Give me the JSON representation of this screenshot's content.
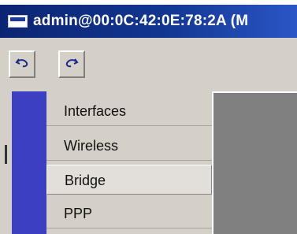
{
  "window": {
    "title": "admin@00:0C:42:0E:78:2A (M"
  },
  "toolbar": {
    "undo_icon": "undo-arrow-icon",
    "redo_icon": "redo-arrow-icon"
  },
  "menu": {
    "items": [
      {
        "label": "Interfaces"
      },
      {
        "label": "Wireless"
      },
      {
        "label": "Bridge"
      },
      {
        "label": "PPP"
      }
    ]
  },
  "colors": {
    "titlebar": "#123690",
    "side_bar": "#3d3fc2",
    "panel": "#d4d0c8",
    "workspace": "#808080"
  }
}
